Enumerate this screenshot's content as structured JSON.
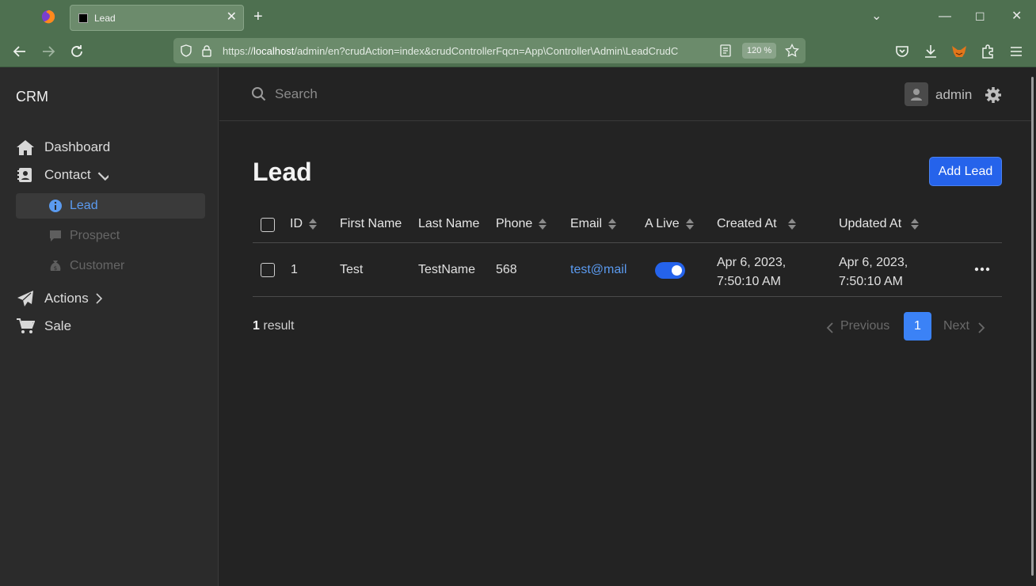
{
  "browser": {
    "tab_title": "Lead",
    "url_prefix": "https://",
    "url_host": "localhost",
    "url_rest": "/admin/en?crudAction=index&crudControllerFqcn=App\\Controller\\Admin\\LeadCrudC",
    "zoom": "120 %"
  },
  "sidebar": {
    "brand": "CRM",
    "items": {
      "dashboard": "Dashboard",
      "contact": "Contact",
      "lead": "Lead",
      "prospect": "Prospect",
      "customer": "Customer",
      "actions": "Actions",
      "sale": "Sale"
    }
  },
  "header": {
    "search_placeholder": "Search",
    "username": "admin"
  },
  "main": {
    "title": "Lead",
    "add_button": "Add Lead",
    "columns": {
      "id": "ID",
      "first_name": "First Name",
      "last_name": "Last Name",
      "phone": "Phone",
      "email": "Email",
      "alive": "A Live",
      "created_at": "Created At",
      "updated_at": "Updated At"
    },
    "rows": [
      {
        "id": "1",
        "first_name": "Test",
        "last_name": "TestName",
        "phone": "568",
        "email": "test@mail",
        "alive": true,
        "created_at_line1": "Apr 6, 2023,",
        "created_at_line2": "7:50:10 AM",
        "updated_at_line1": "Apr 6, 2023,",
        "updated_at_line2": "7:50:10 AM"
      }
    ],
    "result_count": "1",
    "result_label": "result",
    "pagination": {
      "previous": "Previous",
      "current_page": "1",
      "next": "Next"
    }
  },
  "colors": {
    "accent": "#2563eb",
    "link": "#5b9bf0",
    "chrome": "#4e7050"
  }
}
